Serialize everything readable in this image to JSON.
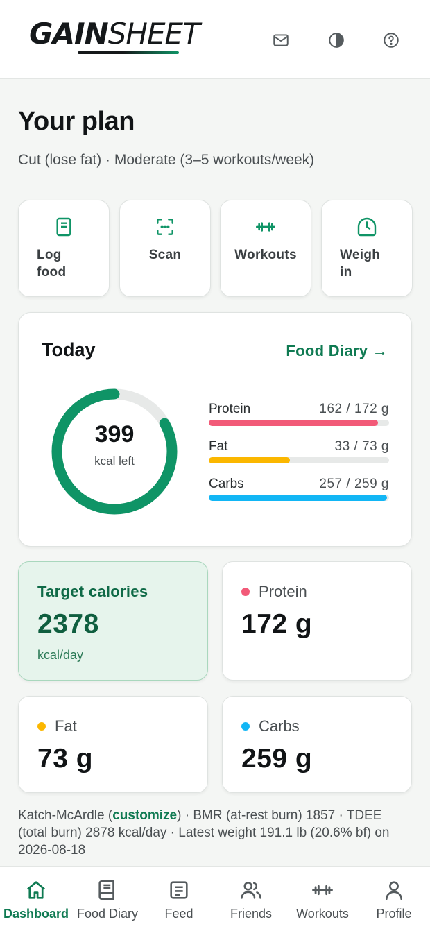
{
  "header": {
    "logo_bold": "GAIN",
    "logo_light": "SHEET",
    "icons": [
      "mail-icon",
      "contrast-icon",
      "help-icon"
    ]
  },
  "plan": {
    "title": "Your plan",
    "subtitle": "Cut (lose fat) · Moderate (3–5 workouts/week)"
  },
  "quick_actions": [
    {
      "label": "Log food",
      "icon": "document-icon"
    },
    {
      "label": "Scan",
      "icon": "scan-icon"
    },
    {
      "label": "Workouts",
      "icon": "dumbbell-icon"
    },
    {
      "label": "Weigh in",
      "icon": "scale-clock-icon"
    }
  ],
  "today": {
    "title": "Today",
    "link": "Food Diary →",
    "kcal_left": "399",
    "kcal_unit": "kcal left",
    "ring_progress": 0.832,
    "macros": [
      {
        "name": "Protein",
        "value": "162 / 172 g",
        "progress": 0.94,
        "color": "#f25a78"
      },
      {
        "name": "Fat",
        "value": "33 / 73 g",
        "progress": 0.45,
        "color": "#fbb700"
      },
      {
        "name": "Carbs",
        "value": "257 / 259 g",
        "progress": 0.99,
        "color": "#12b6f5"
      }
    ]
  },
  "stats": {
    "target": {
      "label": "Target calories",
      "value": "2378",
      "unit": "kcal/day"
    },
    "protein": {
      "label": "Protein",
      "value": "172 g",
      "color": "#f25a78"
    },
    "fat": {
      "label": "Fat",
      "value": "73 g",
      "color": "#fbb700"
    },
    "carbs": {
      "label": "Carbs",
      "value": "259 g",
      "color": "#12b6f5"
    }
  },
  "footnote": {
    "prefix": "Katch-McArdle (",
    "link": "customize",
    "suffix": ") · BMR (at-rest burn) 1857 · TDEE (total burn) 2878 kcal/day · Latest weight 191.1 lb (20.6% bf) on 2026-08-18"
  },
  "nav": [
    {
      "label": "Dashboard",
      "icon": "home-icon",
      "active": true
    },
    {
      "label": "Food Diary",
      "icon": "book-icon"
    },
    {
      "label": "Feed",
      "icon": "feed-icon"
    },
    {
      "label": "Friends",
      "icon": "friends-icon"
    },
    {
      "label": "Workouts",
      "icon": "dumbbell-icon"
    },
    {
      "label": "Profile",
      "icon": "profile-icon"
    }
  ],
  "colors": {
    "accent": "#0f9466",
    "accent_dark": "#0f7a52",
    "track": "#e7e9e8"
  }
}
